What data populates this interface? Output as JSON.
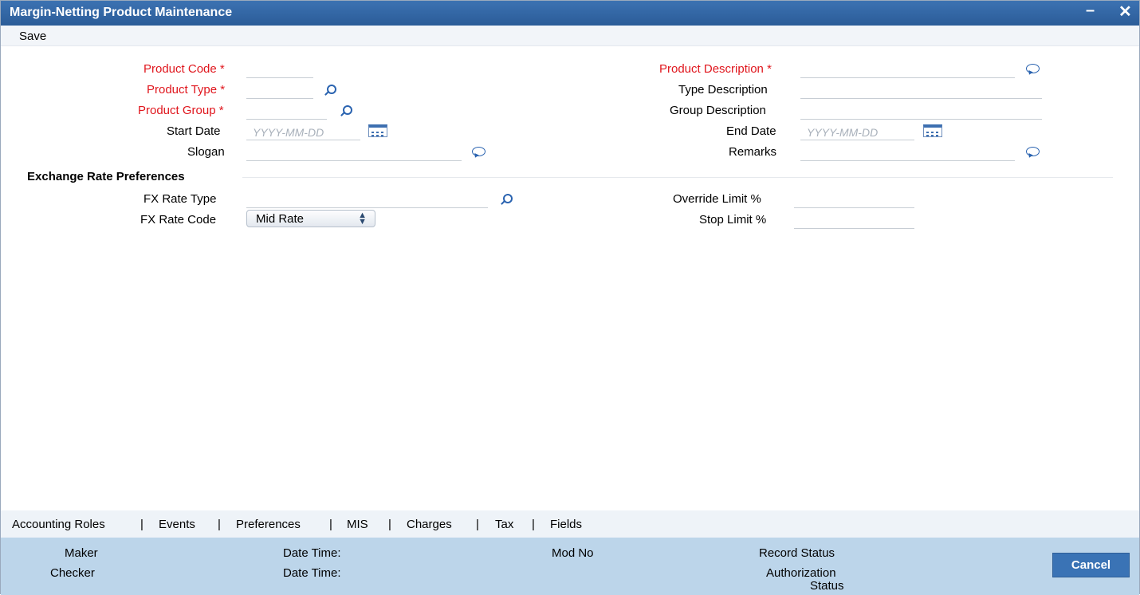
{
  "window": {
    "title": "Margin-Netting Product Maintenance",
    "minimize": "–",
    "close": "✕"
  },
  "toolbar": {
    "save_label": "Save"
  },
  "form": {
    "product_code": {
      "label": "Product Code",
      "required": "*",
      "value": ""
    },
    "product_type": {
      "label": "Product Type",
      "required": "*",
      "value": ""
    },
    "product_group": {
      "label": "Product Group",
      "required": "*",
      "value": ""
    },
    "start_date": {
      "label": "Start Date",
      "placeholder": "YYYY-MM-DD"
    },
    "slogan": {
      "label": "Slogan",
      "value": ""
    },
    "product_description": {
      "label": "Product Description",
      "required": "*",
      "value": ""
    },
    "type_description": {
      "label": "Type Description",
      "value": ""
    },
    "group_description": {
      "label": "Group Description",
      "value": ""
    },
    "end_date": {
      "label": "End Date",
      "placeholder": "YYYY-MM-DD"
    },
    "remarks": {
      "label": "Remarks",
      "value": ""
    }
  },
  "fx_section": {
    "heading": "Exchange Rate Preferences",
    "fx_rate_type": {
      "label": "FX Rate Type",
      "value": ""
    },
    "fx_rate_code": {
      "label": "FX Rate Code",
      "selected": "Mid Rate"
    },
    "override_limit": {
      "label": "Override Limit %",
      "value": ""
    },
    "stop_limit": {
      "label": "Stop Limit %",
      "value": ""
    }
  },
  "tabs": [
    "Accounting Roles",
    "Events",
    "Preferences",
    "MIS",
    "Charges",
    "Tax",
    "Fields"
  ],
  "tab_separator": "|",
  "footer": {
    "maker": "Maker",
    "checker": "Checker",
    "date_time_1": "Date Time:",
    "date_time_2": "Date Time:",
    "mod_no": "Mod No",
    "record_status": "Record Status",
    "authorization_status_1": "Authorization",
    "authorization_status_2": "Status",
    "cancel_label": "Cancel"
  },
  "colors": {
    "titlebar": "#2f63a3",
    "required": "#e0161d",
    "footer": "#bcd5ea",
    "accent": "#2a63b0"
  }
}
